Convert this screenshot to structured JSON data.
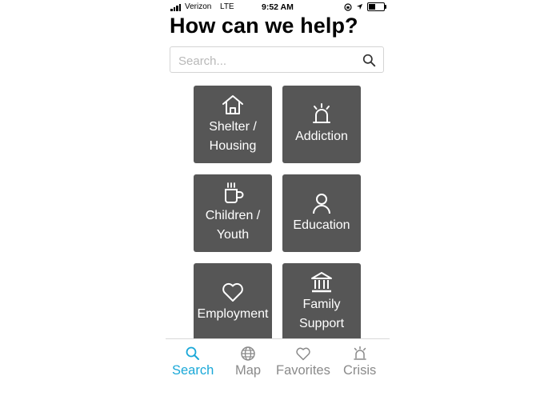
{
  "status_bar": {
    "carrier": "Verizon",
    "network": "LTE",
    "time": "9:52 AM"
  },
  "header": {
    "title": "How can we help?"
  },
  "search": {
    "placeholder": "Search..."
  },
  "categories": [
    {
      "label_line1": "Shelter /",
      "label_line2": "Housing",
      "icon": "house-icon"
    },
    {
      "label_line1": "Addiction",
      "label_line2": "",
      "icon": "siren-icon"
    },
    {
      "label_line1": "Children /",
      "label_line2": "Youth",
      "icon": "coffee-cup-icon"
    },
    {
      "label_line1": "Education",
      "label_line2": "",
      "icon": "person-icon"
    },
    {
      "label_line1": "Employment",
      "label_line2": "",
      "icon": "heart-icon"
    },
    {
      "label_line1": "Family",
      "label_line2": "Support",
      "icon": "bank-icon"
    }
  ],
  "tabs": [
    {
      "label": "Search",
      "icon": "search-icon",
      "active": true
    },
    {
      "label": "Map",
      "icon": "globe-icon",
      "active": false
    },
    {
      "label": "Favorites",
      "icon": "heart-icon",
      "active": false
    },
    {
      "label": "Crisis",
      "icon": "siren-icon",
      "active": false
    }
  ],
  "colors": {
    "tile": "#565656",
    "accent": "#1aa8d8",
    "tab_inactive": "#8a8a8a"
  }
}
